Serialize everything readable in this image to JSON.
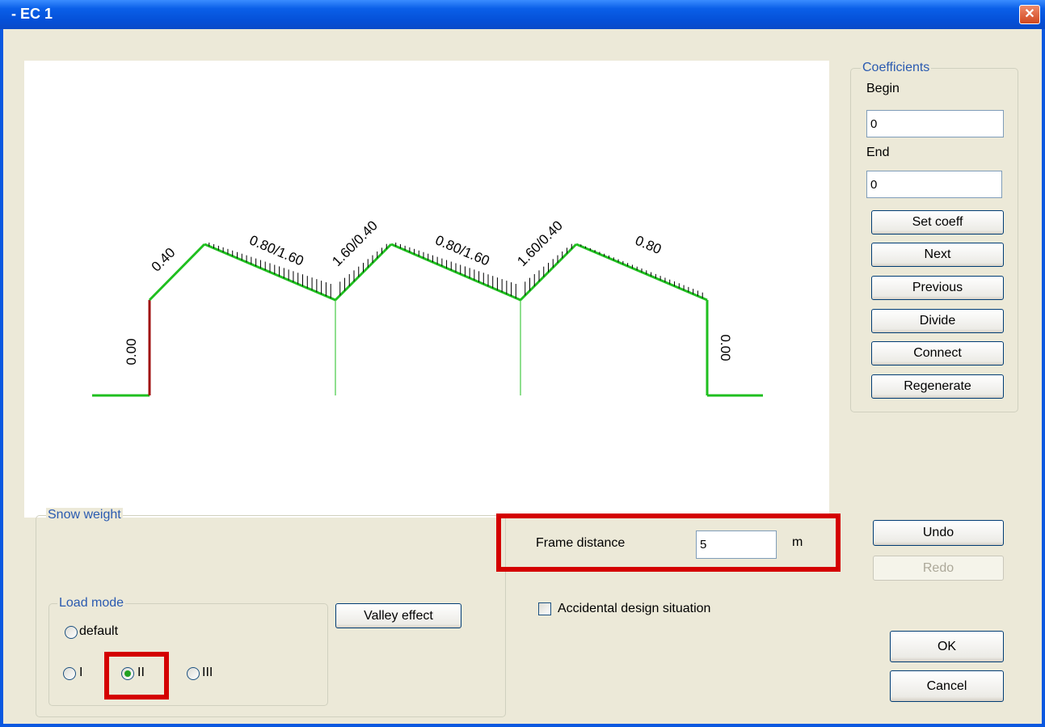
{
  "window": {
    "title": "- EC 1",
    "close_glyph": "✕"
  },
  "diagram": {
    "labels": {
      "left_wall": "0.00",
      "slope1": "0.40",
      "slope2": "0.80/1.60",
      "slope3": "1.60/0.40",
      "slope4": "0.80/1.60",
      "slope5": "1.60/0.40",
      "slope6": "0.80",
      "right_wall": "0.00"
    },
    "colors": {
      "roof": "#1fbf1f",
      "selected_wall": "#a01010"
    }
  },
  "coefficients": {
    "legend": "Coefficients",
    "begin_label": "Begin",
    "begin_value": "0",
    "end_label": "End",
    "end_value": "0",
    "buttons": {
      "set_coeff": "Set coeff",
      "next": "Next",
      "previous": "Previous",
      "divide": "Divide",
      "connect": "Connect",
      "regenerate": "Regenerate"
    }
  },
  "snow_weight": {
    "legend": "Snow weight",
    "load_mode_legend": "Load mode",
    "options": {
      "default": "default",
      "i": "I",
      "ii": "II",
      "iii": "III"
    },
    "selected": "II",
    "valley_effect": "Valley effect"
  },
  "frame_distance": {
    "label": "Frame distance",
    "value": "5",
    "unit": "m"
  },
  "accidental": {
    "label": "Accidental design situation",
    "checked": false
  },
  "actions": {
    "undo": "Undo",
    "redo": "Redo",
    "ok": "OK",
    "cancel": "Cancel"
  },
  "highlight_color": "#d40000"
}
